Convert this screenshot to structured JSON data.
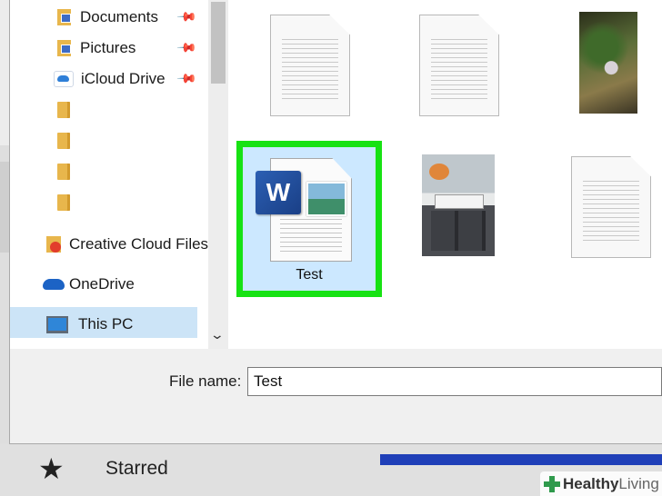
{
  "nav": {
    "items": [
      {
        "label": "Documents",
        "pinned": true
      },
      {
        "label": "Pictures",
        "pinned": true
      },
      {
        "label": "iCloud Drive",
        "pinned": true
      },
      {
        "label": "Creative Cloud Files"
      },
      {
        "label": "OneDrive"
      },
      {
        "label": "This PC",
        "selected": true
      }
    ]
  },
  "files": {
    "selected_label": "Test"
  },
  "footer": {
    "file_name_label": "File name:",
    "file_name_value": "Test"
  },
  "background": {
    "starred_label": "Starred"
  },
  "watermark": {
    "brand_bold": "Healthy",
    "brand_light": "Living"
  },
  "colors": {
    "selection_border": "#17e213",
    "selection_fill": "#cce8ff",
    "nav_selected": "#cce4f7"
  }
}
